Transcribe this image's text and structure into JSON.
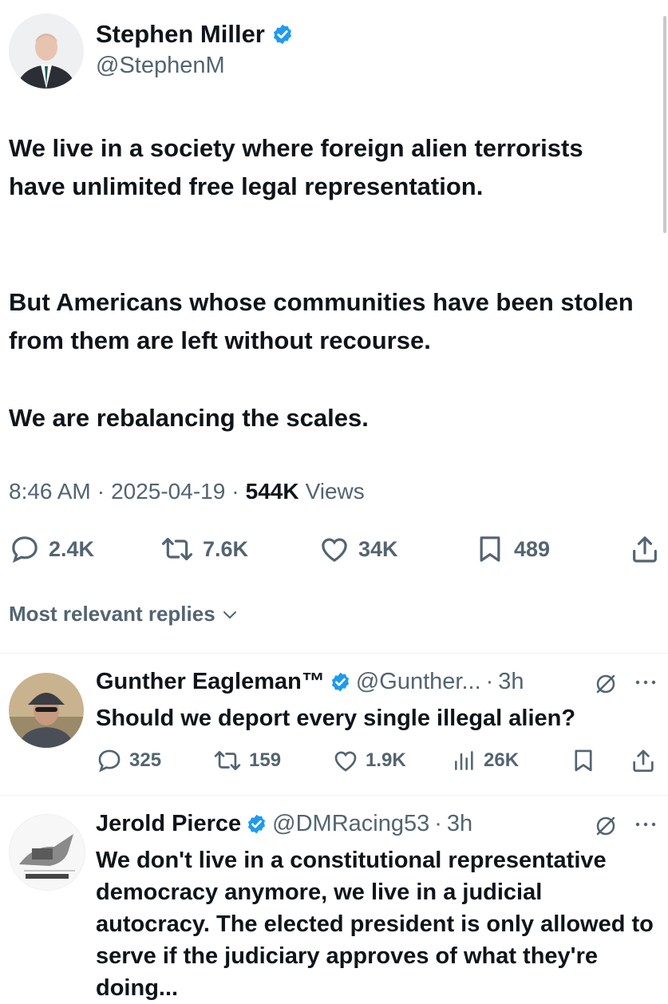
{
  "tweet": {
    "author_name": "Stephen Miller",
    "handle": "@StephenM",
    "text_p1": "We live in a society where foreign alien terrorists have unlimited free legal representation.",
    "text_p2": "But Americans whose communities have been stolen from them are left without recourse.",
    "text_p3": "We are rebalancing the scales.",
    "time": "8:46 AM",
    "date": "2025-04-19",
    "views_count": "544K",
    "views_label": "Views",
    "replies": "2.4K",
    "reposts": "7.6K",
    "likes": "34K",
    "bookmarks": "489"
  },
  "sort_label": "Most relevant replies",
  "replies": [
    {
      "name": "Gunther Eagleman™",
      "handle": "@Gunther...",
      "time": "3h",
      "text": "Should we deport every single illegal alien?",
      "replies": "325",
      "reposts": "159",
      "likes": "1.9K",
      "views": "26K"
    },
    {
      "name": "Jerold Pierce",
      "handle": "@DMRacing53",
      "time": "3h",
      "text": "We don't live in a constitutional representative democracy anymore, we live in a judicial autocracy. The elected president is only allowed to serve if the judiciary approves of what they're doing..."
    }
  ],
  "separator": "·",
  "colors": {
    "accent": "#1d9bf0",
    "text": "#0f1419",
    "muted": "#536471"
  }
}
